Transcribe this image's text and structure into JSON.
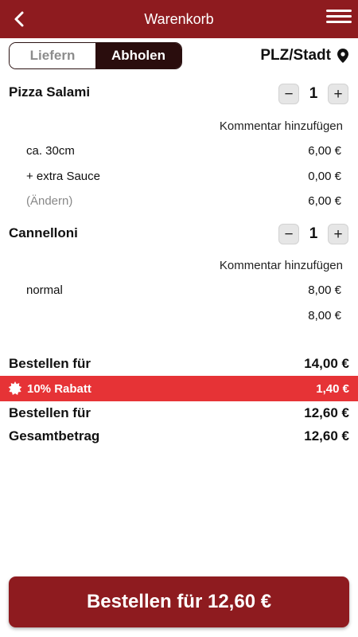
{
  "header": {
    "title": "Warenkorb",
    "bar_color": "#8e1b1f",
    "back_icon": "chevron-left-icon",
    "menu_icon": "hamburger-menu-icon"
  },
  "mode": {
    "options": [
      "Liefern",
      "Abholen"
    ],
    "selected": "Abholen"
  },
  "location": {
    "label": "PLZ/Stadt",
    "icon": "location-pin-icon"
  },
  "cart": {
    "items": [
      {
        "name": "Pizza Salami",
        "quantity": "1",
        "comment_link": "Kommentar hinzufügen",
        "lines": [
          {
            "label": "ca. 30cm",
            "price": "6,00 €"
          },
          {
            "label": "+ extra Sauce",
            "price": "0,00 €"
          },
          {
            "label": "(Ändern)",
            "price": "6,00 €"
          }
        ]
      },
      {
        "name": "Cannelloni",
        "quantity": "1",
        "comment_link": "Kommentar hinzufügen",
        "lines": [
          {
            "label": "normal",
            "price": "8,00 €"
          },
          {
            "label": "",
            "price": "8,00 €"
          }
        ]
      }
    ],
    "stepper": {
      "minus": "−",
      "plus": "+"
    }
  },
  "summary": {
    "subtotal_label": "Bestellen für",
    "subtotal_value": "14,00 €",
    "discount_label": "10% Rabatt",
    "discount_value": "1,40 €",
    "discount_icon": "badge-star-icon",
    "discount_color": "#e63336",
    "after_discount_label": "Bestellen für",
    "after_discount_value": "12,60 €",
    "total_label": "Gesamtbetrag",
    "total_value": "12,60 €"
  },
  "checkout": {
    "button_label": "Bestellen für 12,60 €"
  }
}
